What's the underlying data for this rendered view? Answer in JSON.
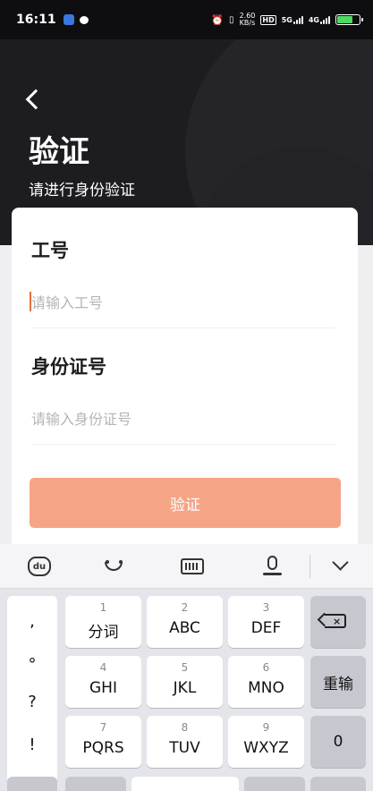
{
  "status_bar": {
    "time": "16:11",
    "speed_top": "2.60",
    "speed_bottom": "KB/s",
    "hd": "HD",
    "net_5g": "5G",
    "net_4g": "4G",
    "battery_level_percent": 72
  },
  "header": {
    "title": "验证",
    "subtitle": "请进行身份验证"
  },
  "form": {
    "employee_id": {
      "label": "工号",
      "placeholder": "请输入工号",
      "value": ""
    },
    "id_number": {
      "label": "身份证号",
      "placeholder": "请输入身份证号",
      "value": ""
    },
    "submit_label": "验证"
  },
  "keyboard": {
    "toolbar": {
      "logo_text": "du",
      "icons": [
        "du-bear-icon",
        "emoji-icon",
        "keyboard-switch-icon",
        "microphone-icon",
        "collapse-keyboard-icon"
      ]
    },
    "symbols": [
      ",",
      "°",
      "?",
      "!"
    ],
    "keys": [
      {
        "num": "1",
        "label": "分词"
      },
      {
        "num": "2",
        "label": "ABC"
      },
      {
        "num": "3",
        "label": "DEF"
      },
      {
        "num": "4",
        "label": "GHI"
      },
      {
        "num": "5",
        "label": "JKL"
      },
      {
        "num": "6",
        "label": "MNO"
      },
      {
        "num": "7",
        "label": "PQRS"
      },
      {
        "num": "8",
        "label": "TUV"
      },
      {
        "num": "9",
        "label": "WXYZ"
      }
    ],
    "reenter_label": "重输",
    "zero_label": "0"
  }
}
